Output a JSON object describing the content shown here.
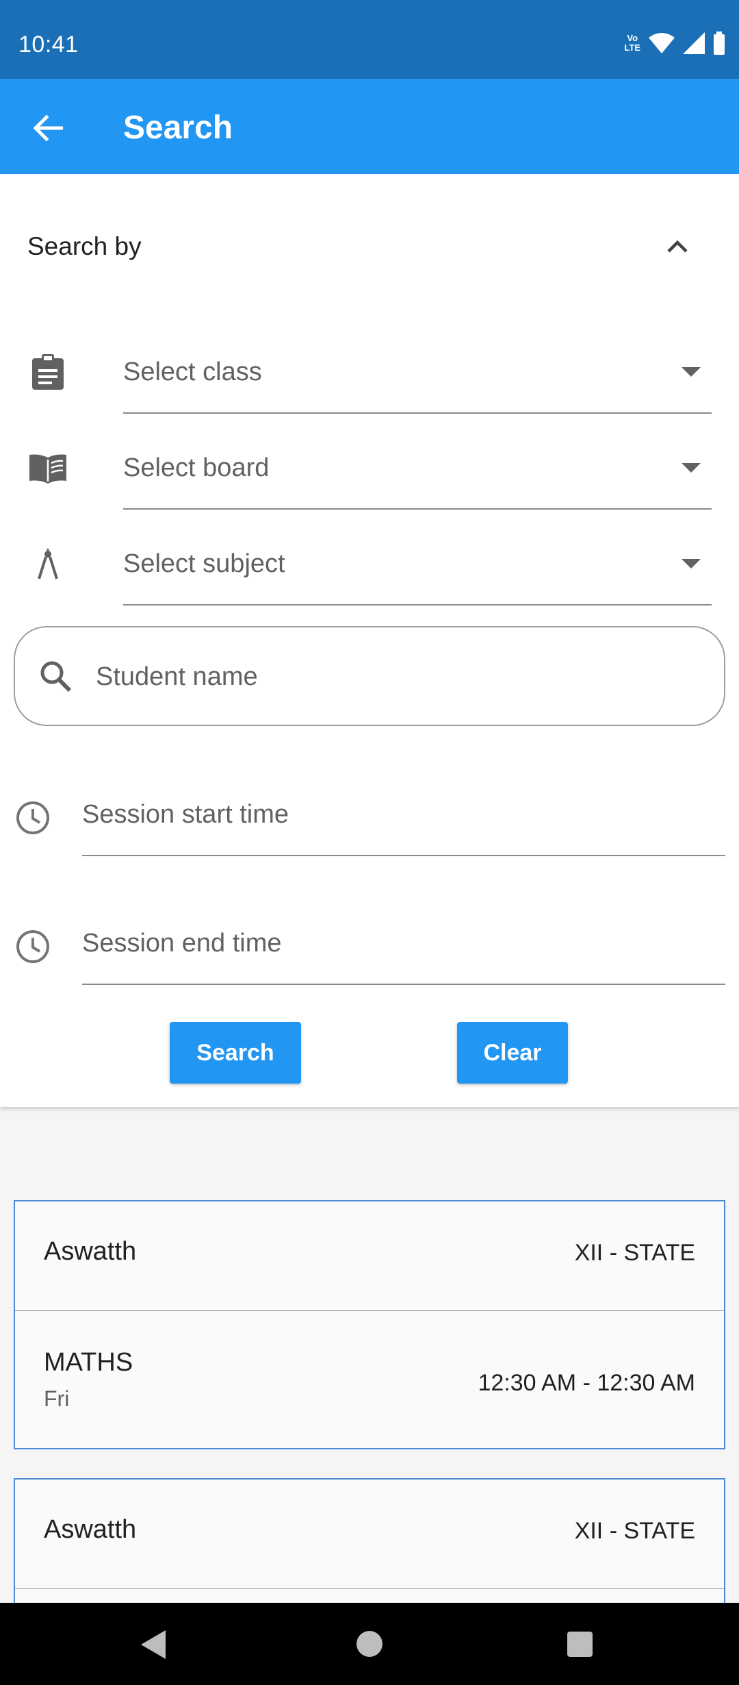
{
  "status_bar": {
    "time": "10:41",
    "volte_top": "Vo",
    "volte_bottom": "LTE"
  },
  "app_bar": {
    "title": "Search"
  },
  "filters": {
    "header_label": "Search by",
    "class_placeholder": "Select class",
    "board_placeholder": "Select board",
    "subject_placeholder": "Select subject",
    "student_placeholder": "Student name",
    "start_time_placeholder": "Session start time",
    "end_time_placeholder": "Session end time",
    "search_button": "Search",
    "clear_button": "Clear"
  },
  "results": [
    {
      "name": "Aswatth",
      "class_board": "XII - STATE",
      "subject": "MATHS",
      "day": "Fri",
      "time_range": "12:30 AM - 12:30 AM"
    },
    {
      "name": "Aswatth",
      "class_board": "XII - STATE",
      "subject": "",
      "day": "",
      "time_range": ""
    }
  ],
  "icons": {
    "back": "arrow-left-icon",
    "collapse": "chevron-up-icon",
    "class": "clipboard-icon",
    "board": "book-icon",
    "subject": "compass-icon",
    "search": "search-icon",
    "clock": "clock-icon"
  },
  "colors": {
    "primary": "#2196f3",
    "status_bar": "#1b6fb6",
    "card_border": "#4a8ad4"
  }
}
